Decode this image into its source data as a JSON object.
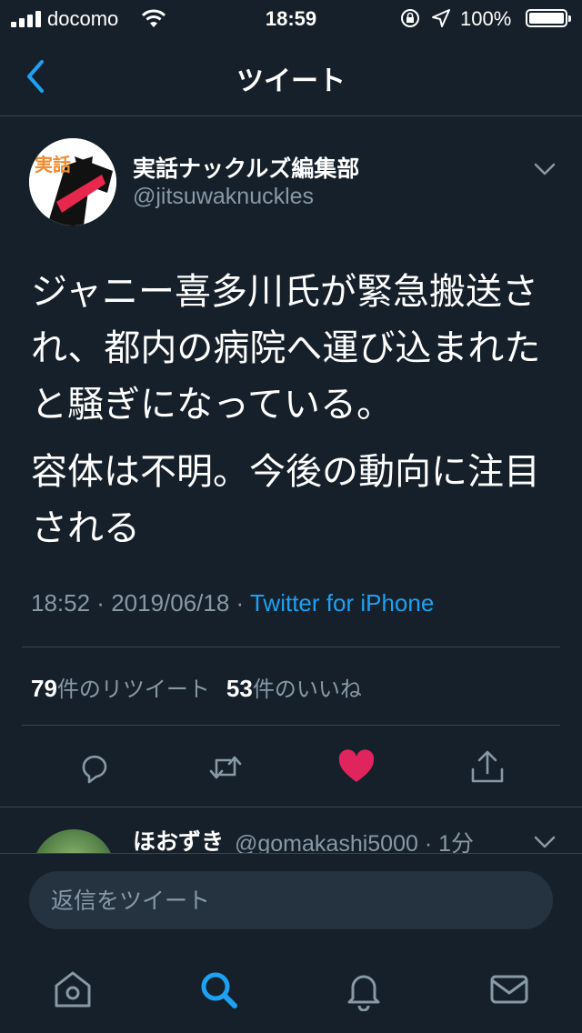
{
  "status_bar": {
    "carrier": "docomo",
    "time": "18:59",
    "battery": "100%"
  },
  "header": {
    "title": "ツイート"
  },
  "tweet": {
    "author_name": "実話ナックルズ編集部",
    "handle": "@jitsuwaknuckles",
    "avatar_text": "実話",
    "paragraphs": [
      "ジャニー喜多川氏が緊急搬送され、都内の病院へ運び込まれたと騒ぎになっている。",
      "容体は不明。今後の動向に注目される"
    ],
    "time": "18:52",
    "date": "2019/06/18",
    "separator": " · ",
    "source": "Twitter for iPhone",
    "retweet_count": "79",
    "retweet_label": "件のリツイート",
    "like_count": "53",
    "like_label": "件のいいね",
    "liked": true,
    "like_color": "#e0245e",
    "accent_color": "#1da1f2"
  },
  "reply": {
    "name": "ほおずき",
    "handle": "@gomakashi5000 · 1分"
  },
  "reply_box": {
    "placeholder": "返信をツイート"
  },
  "tabs": [
    {
      "icon": "home-icon"
    },
    {
      "icon": "search-icon",
      "active": true
    },
    {
      "icon": "notifications-icon"
    },
    {
      "icon": "messages-icon"
    }
  ]
}
